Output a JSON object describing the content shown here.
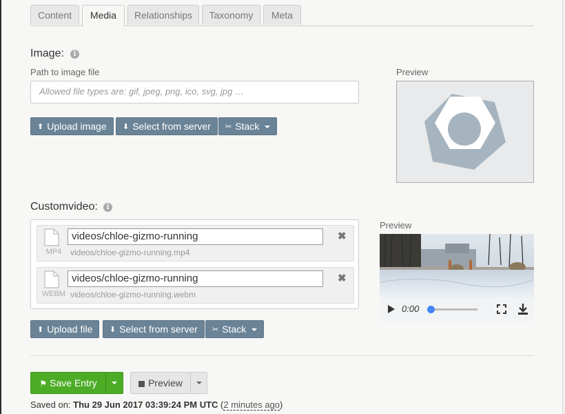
{
  "tabs": [
    {
      "label": "Content",
      "active": false
    },
    {
      "label": "Media",
      "active": true
    },
    {
      "label": "Relationships",
      "active": false
    },
    {
      "label": "Taxonomy",
      "active": false
    },
    {
      "label": "Meta",
      "active": false
    }
  ],
  "image_field": {
    "label": "Image:",
    "sublabel": "Path to image file",
    "placeholder": "Allowed file types are: gif, jpeg, png, ico, svg, jpg …",
    "preview_label": "Preview",
    "buttons": {
      "upload": "Upload image",
      "select": "Select from server",
      "stack": "Stack"
    }
  },
  "video_field": {
    "label": "Customvideo:",
    "preview_label": "Preview",
    "items": [
      {
        "type": "MP4",
        "value": "videos/chloe-gizmo-running",
        "path": "videos/chloe-gizmo-running.mp4"
      },
      {
        "type": "WEBM",
        "value": "videos/chloe-gizmo-running",
        "path": "videos/chloe-gizmo-running.webm"
      }
    ],
    "player_time": "0:00",
    "progress": 0,
    "buttons": {
      "upload": "Upload file",
      "select": "Select from server",
      "stack": "Stack"
    }
  },
  "footer": {
    "save_label": "Save Entry",
    "preview_label": "Preview",
    "saved_prefix": "Saved on:",
    "saved_date": "Thu 29 Jun 2017 03:39:24 PM UTC",
    "saved_relative": "2 minutes ago"
  },
  "colors": {
    "accent": "#6b8396",
    "save": "#4cac26",
    "progress": "#4285f4"
  },
  "icons": [
    "info-icon",
    "upload-icon",
    "download-icon",
    "paperclip-icon",
    "file-icon",
    "close-icon",
    "play-icon",
    "fullscreen-icon",
    "flag-icon",
    "external-link-icon",
    "caret-down-icon"
  ]
}
